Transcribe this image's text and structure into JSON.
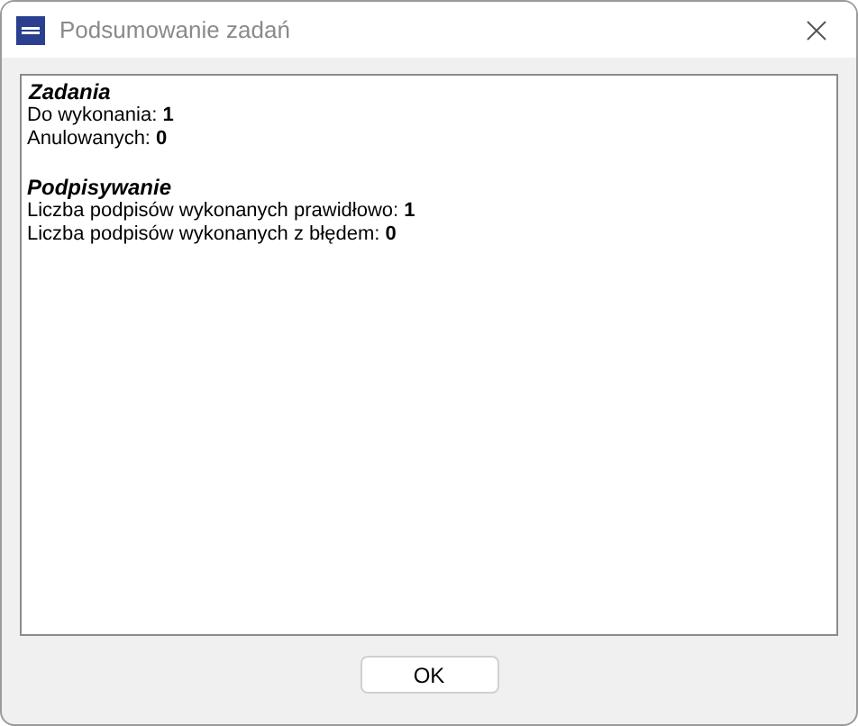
{
  "window": {
    "title": "Podsumowanie zadań"
  },
  "sections": [
    {
      "heading": "Zadania",
      "lines": [
        {
          "label": "Do wykonania: ",
          "value": "1"
        },
        {
          "label": "Anulowanych: ",
          "value": "0"
        }
      ]
    },
    {
      "heading": "Podpisywanie",
      "lines": [
        {
          "label": "Liczba podpisów wykonanych prawidłowo: ",
          "value": "1"
        },
        {
          "label": "Liczba podpisów wykonanych z błędem: ",
          "value": "0"
        }
      ]
    }
  ],
  "buttons": [
    "OK"
  ]
}
